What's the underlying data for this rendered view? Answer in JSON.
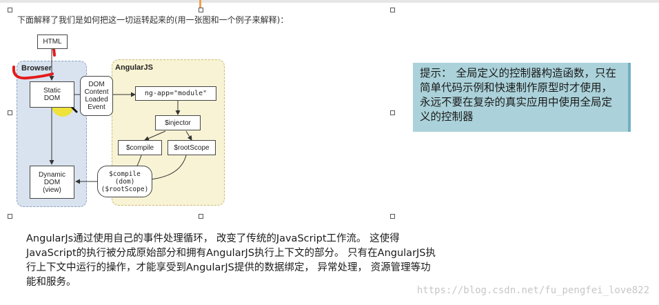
{
  "intro": "下面解释了我们是如何把这一切运转起来的(用一张图和一个例子来解释)：",
  "diagram": {
    "html_label": "HTML",
    "browser_title": "Browser",
    "angular_title": "AngularJS",
    "static_dom": [
      "Static",
      "DOM"
    ],
    "dom_event": [
      "DOM",
      "Content",
      "Loaded",
      "Event"
    ],
    "ng_app": "ng-app=\"module\"",
    "injector": "$injector",
    "compile": "$compile",
    "rootscope": "$rootScope",
    "compile_call": [
      "$compile",
      "(dom)",
      "($rootScope)"
    ],
    "dynamic_dom": [
      "Dynamic",
      "DOM",
      "(view)"
    ]
  },
  "tip": {
    "label": "提示：",
    "text": "全局定义的控制器构造函数，只在简单代码示例和快速制作原型时才使用，永远不要在复杂的真实应用中使用全局定义的控制器"
  },
  "paragraph": [
    "AngularJs通过使用自己的事件处理循环， 改变了传统的JavaScript工作流。 这使得",
    "JavaScript的执行被分成原始部分和拥有AngularJS执行上下文的部分。 只有在AngularJS执",
    "行上下文中运行的操作，才能享受到AngularJS提供的数据绑定， 异常处理， 资源管理等功",
    "能和服务。"
  ],
  "watermark": "https://blog.csdn.net/fu_pengfei_love822",
  "colors": {
    "tip_bg": "#abd2da",
    "annotation": "#e41b1b",
    "highlight": "#f2e21a"
  }
}
